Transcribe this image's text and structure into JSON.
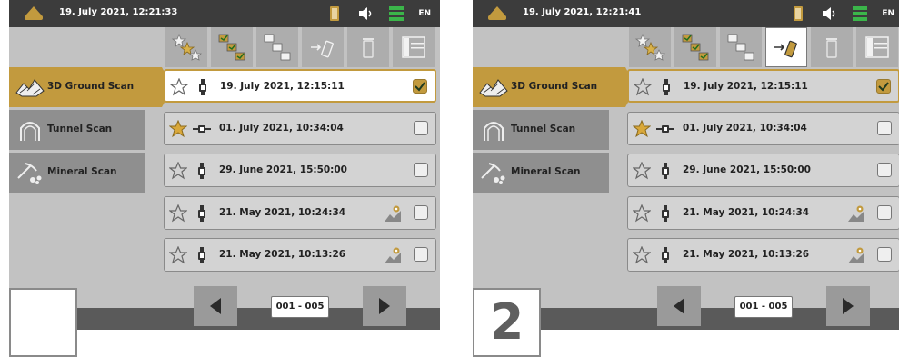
{
  "colors": {
    "accent": "#c29a3e",
    "statusbar": "#3c3c3c",
    "screen_bg": "#c2c2c2"
  },
  "screens": [
    {
      "status": {
        "time": "19. July 2021, 12:21:33",
        "language": "EN"
      },
      "active_tool": null,
      "step_label": "",
      "sidebar": [
        {
          "label": "3D Ground Scan",
          "icon": "ground-scan-icon",
          "active": true
        },
        {
          "label": "Tunnel Scan",
          "icon": "tunnel-icon",
          "active": false
        },
        {
          "label": "Mineral Scan",
          "icon": "mineral-icon",
          "active": false
        }
      ],
      "rows": [
        {
          "label": "19. July 2021, 12:15:11",
          "starred": false,
          "device": "probe",
          "checked": true,
          "map": false,
          "selected": true
        },
        {
          "label": "01. July 2021, 10:34:04",
          "starred": true,
          "device": "tunnel-probe",
          "checked": false,
          "map": false,
          "selected": false
        },
        {
          "label": "29. June 2021, 15:50:00",
          "starred": false,
          "device": "probe",
          "checked": false,
          "map": false,
          "selected": false
        },
        {
          "label": "21. May 2021, 10:24:34",
          "starred": false,
          "device": "probe",
          "checked": false,
          "map": true,
          "selected": false
        },
        {
          "label": "21. May 2021, 10:13:26",
          "starred": false,
          "device": "probe",
          "checked": false,
          "map": true,
          "selected": false
        }
      ],
      "pagination": "001 - 005"
    },
    {
      "status": {
        "time": "19. July 2021, 12:21:41",
        "language": "EN"
      },
      "active_tool": "export",
      "step_label": "2",
      "sidebar": [
        {
          "label": "3D Ground Scan",
          "icon": "ground-scan-icon",
          "active": true
        },
        {
          "label": "Tunnel Scan",
          "icon": "tunnel-icon",
          "active": false
        },
        {
          "label": "Mineral Scan",
          "icon": "mineral-icon",
          "active": false
        }
      ],
      "rows": [
        {
          "label": "19. July 2021, 12:15:11",
          "starred": false,
          "device": "probe",
          "checked": true,
          "map": false,
          "selected": true
        },
        {
          "label": "01. July 2021, 10:34:04",
          "starred": true,
          "device": "tunnel-probe",
          "checked": false,
          "map": false,
          "selected": false
        },
        {
          "label": "29. June 2021, 15:50:00",
          "starred": false,
          "device": "probe",
          "checked": false,
          "map": false,
          "selected": false
        },
        {
          "label": "21. May 2021, 10:24:34",
          "starred": false,
          "device": "probe",
          "checked": false,
          "map": true,
          "selected": false
        },
        {
          "label": "21. May 2021, 10:13:26",
          "starred": false,
          "device": "probe",
          "checked": false,
          "map": true,
          "selected": false
        }
      ],
      "pagination": "001 - 005"
    }
  ],
  "toolbar": [
    "favorites-icon",
    "select-all-icon",
    "deselect-icon",
    "export-icon",
    "delete-icon",
    "details-icon"
  ]
}
